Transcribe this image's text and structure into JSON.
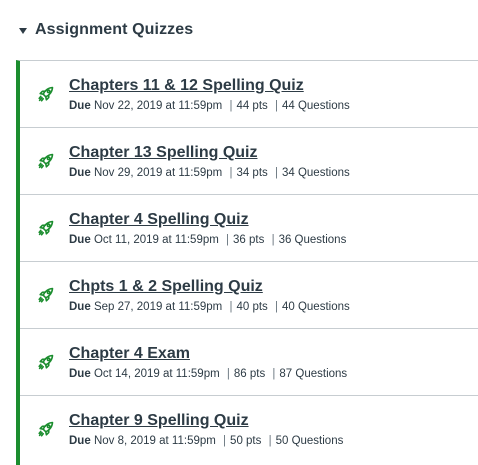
{
  "group": {
    "title": "Assignment Quizzes"
  },
  "colors": {
    "accent_border": "#1b8d2e",
    "icon_green": "#1b8d2e",
    "text": "#2d3b45"
  },
  "icon_name": "rocket-icon",
  "labels": {
    "due": "Due",
    "separator": "|"
  },
  "quizzes": [
    {
      "title": "Chapters 11 & 12 Spelling Quiz",
      "due": "Nov 22, 2019 at 11:59pm",
      "points": "44 pts",
      "questions": "44 Questions"
    },
    {
      "title": "Chapter 13 Spelling Quiz",
      "due": "Nov 29, 2019 at 11:59pm",
      "points": "34 pts",
      "questions": "34 Questions"
    },
    {
      "title": "Chapter 4 Spelling Quiz",
      "due": "Oct 11, 2019 at 11:59pm",
      "points": "36 pts",
      "questions": "36 Questions"
    },
    {
      "title": "Chpts 1 & 2 Spelling Quiz",
      "due": "Sep 27, 2019 at 11:59pm",
      "points": "40 pts",
      "questions": "40 Questions"
    },
    {
      "title": "Chapter 4 Exam",
      "due": "Oct 14, 2019 at 11:59pm",
      "points": "86 pts",
      "questions": "87 Questions"
    },
    {
      "title": "Chapter 9 Spelling Quiz",
      "due": "Nov 8, 2019 at 11:59pm",
      "points": "50 pts",
      "questions": "50 Questions"
    }
  ]
}
